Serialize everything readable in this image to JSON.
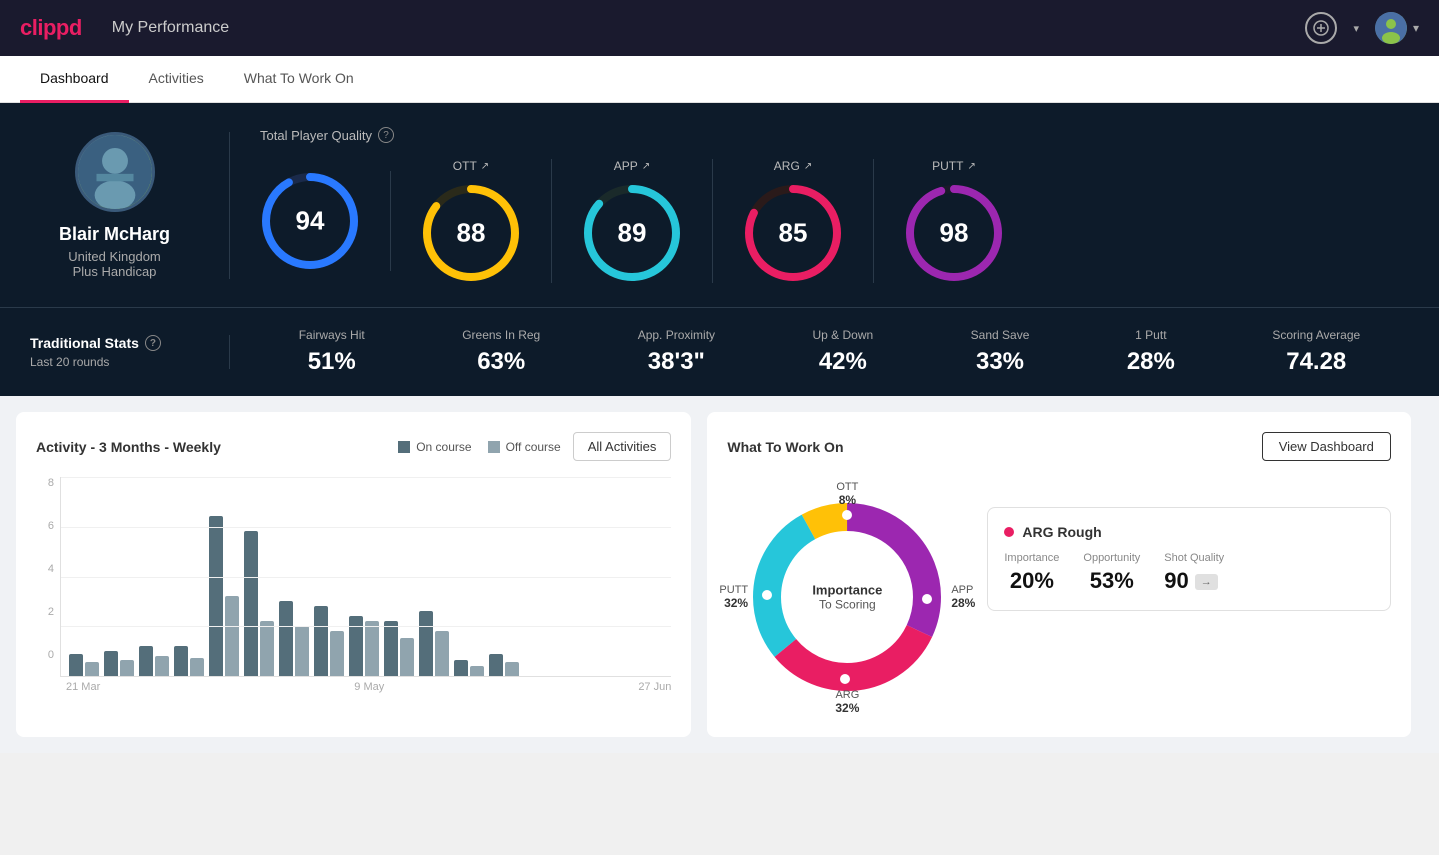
{
  "app": {
    "logo": "clippd",
    "nav_title": "My Performance"
  },
  "tabs": [
    {
      "label": "Dashboard",
      "active": true
    },
    {
      "label": "Activities",
      "active": false
    },
    {
      "label": "What To Work On",
      "active": false
    }
  ],
  "player": {
    "name": "Blair McHarg",
    "country": "United Kingdom",
    "handicap": "Plus Handicap",
    "avatar_emoji": "🏌️"
  },
  "total_quality": {
    "label": "Total Player Quality",
    "value": 94,
    "color": "#2979ff"
  },
  "scores": [
    {
      "label": "OTT",
      "value": 88,
      "color": "#ffc107",
      "track_color": "#3a3a2a"
    },
    {
      "label": "APP",
      "value": 89,
      "color": "#26c6da",
      "track_color": "#1a3a3a"
    },
    {
      "label": "ARG",
      "value": 85,
      "color": "#e91e63",
      "track_color": "#3a1a2a"
    },
    {
      "label": "PUTT",
      "value": 98,
      "color": "#9c27b0",
      "track_color": "#2a1a3a"
    }
  ],
  "traditional_stats": {
    "title": "Traditional Stats",
    "subtitle": "Last 20 rounds",
    "items": [
      {
        "label": "Fairways Hit",
        "value": "51%"
      },
      {
        "label": "Greens In Reg",
        "value": "63%"
      },
      {
        "label": "App. Proximity",
        "value": "38'3\""
      },
      {
        "label": "Up & Down",
        "value": "42%"
      },
      {
        "label": "Sand Save",
        "value": "33%"
      },
      {
        "label": "1 Putt",
        "value": "28%"
      },
      {
        "label": "Scoring Average",
        "value": "74.28"
      }
    ]
  },
  "activity_chart": {
    "title": "Activity - 3 Months - Weekly",
    "legend": {
      "on_course": "On course",
      "off_course": "Off course"
    },
    "all_activities_btn": "All Activities",
    "y_labels": [
      "8",
      "6",
      "4",
      "2",
      "0"
    ],
    "x_labels": [
      "21 Mar",
      "9 May",
      "27 Jun"
    ],
    "bars": [
      {
        "dark": 20,
        "light": 15
      },
      {
        "dark": 18,
        "light": 10
      },
      {
        "dark": 22,
        "light": 12
      },
      {
        "dark": 25,
        "light": 18
      },
      {
        "dark": 85,
        "light": 55
      },
      {
        "dark": 75,
        "light": 45
      },
      {
        "dark": 40,
        "light": 28
      },
      {
        "dark": 38,
        "light": 22
      },
      {
        "dark": 42,
        "light": 30
      },
      {
        "dark": 30,
        "light": 20
      },
      {
        "dark": 35,
        "light": 25
      },
      {
        "dark": 8,
        "light": 5
      },
      {
        "dark": 12,
        "light": 8
      }
    ]
  },
  "what_to_work_on": {
    "title": "What To Work On",
    "view_dashboard_btn": "View Dashboard",
    "donut_center_line1": "Importance",
    "donut_center_line2": "To Scoring",
    "segments": [
      {
        "label": "OTT",
        "value": "8%",
        "color": "#ffc107"
      },
      {
        "label": "APP",
        "value": "28%",
        "color": "#26c6da"
      },
      {
        "label": "ARG",
        "value": "32%",
        "color": "#e91e63"
      },
      {
        "label": "PUTT",
        "value": "32%",
        "color": "#9c27b0"
      }
    ],
    "recommendation": {
      "title": "ARG Rough",
      "metrics": [
        {
          "label": "Importance",
          "value": "20%"
        },
        {
          "label": "Opportunity",
          "value": "53%"
        },
        {
          "label": "Shot Quality",
          "value": "90",
          "badge": ""
        }
      ]
    }
  }
}
